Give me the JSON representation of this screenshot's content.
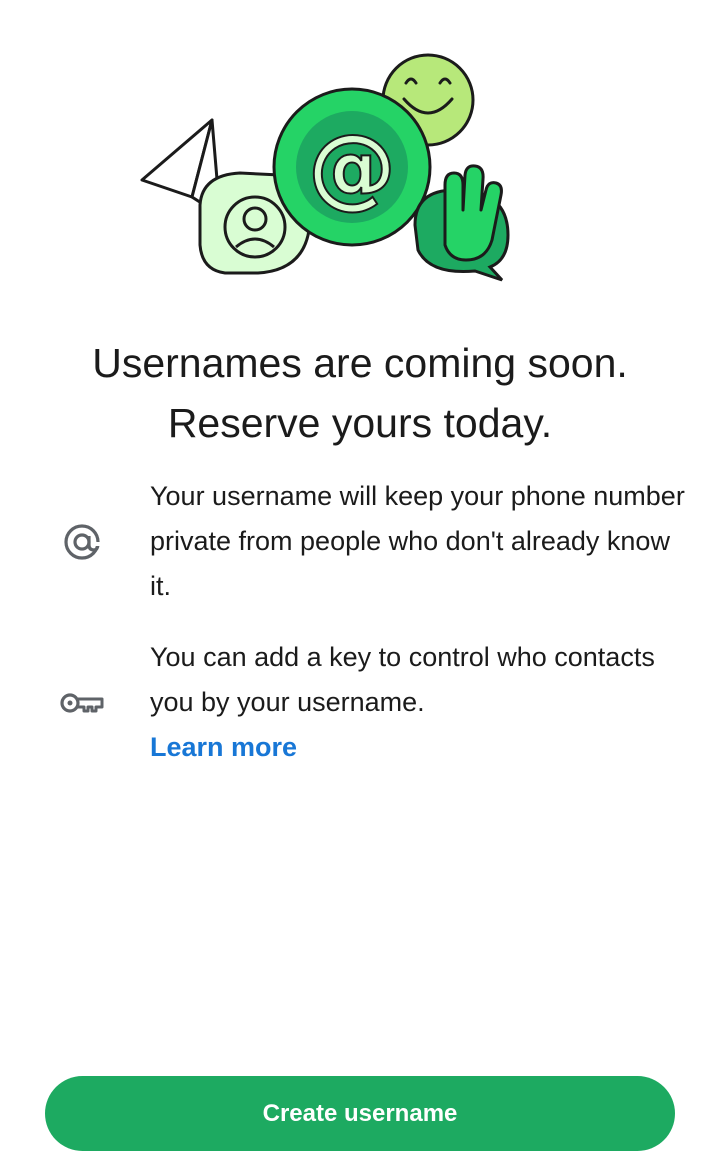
{
  "illustration": {
    "icons": [
      "paper-plane-icon",
      "person-bubble-icon",
      "at-sign-icon",
      "smiley-icon",
      "waving-hand-icon"
    ]
  },
  "header": {
    "title_line1": "Usernames are coming soon.",
    "title_line2": "Reserve yours today."
  },
  "features": [
    {
      "icon": "at-sign-icon",
      "text": "Your username will keep your phone number private from people who don't already know it."
    },
    {
      "icon": "key-icon",
      "text": "You can add a key to control who contacts you by your username.",
      "link_label": "Learn more"
    }
  ],
  "cta": {
    "label": "Create username"
  },
  "colors": {
    "brand_green": "#1daa61",
    "link_blue": "#1877d6",
    "icon_gray": "#5f6368"
  }
}
